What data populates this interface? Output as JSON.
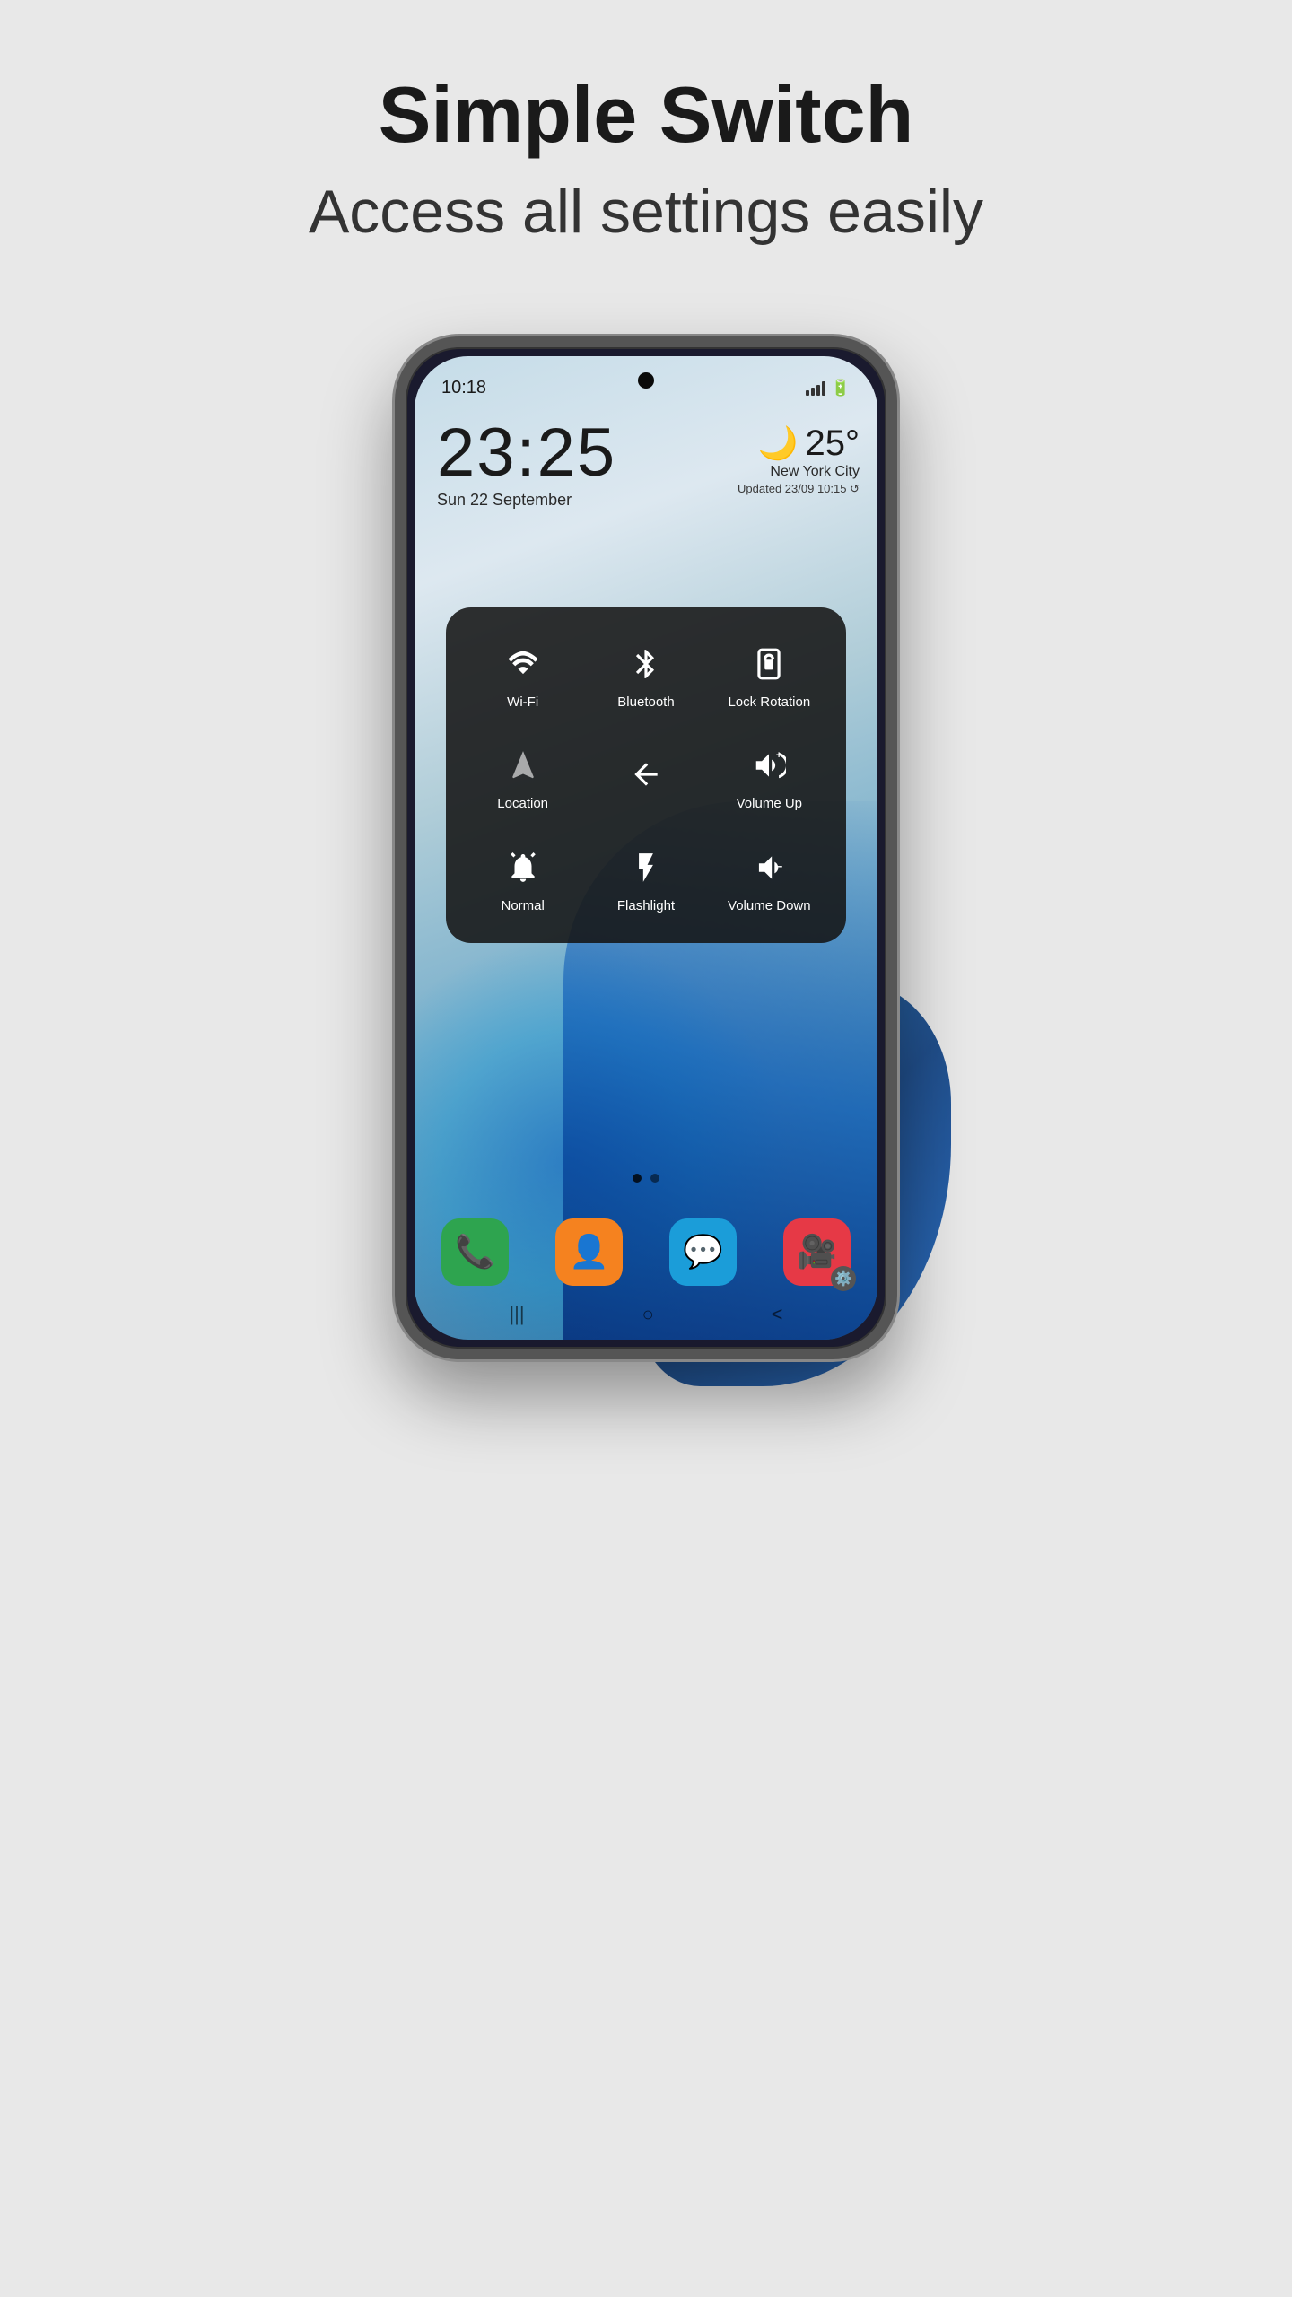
{
  "header": {
    "title": "Simple Switch",
    "subtitle": "Access all settings easily"
  },
  "phone": {
    "status_bar": {
      "time": "10:18",
      "circle_icon": "○"
    },
    "clock": {
      "time": "23:25",
      "date": "Sun 22 September"
    },
    "weather": {
      "icon": "🌙",
      "temp": "25°",
      "city": "New York City",
      "updated": "Updated 23/09 10:15 ↺"
    },
    "control_panel": {
      "items": [
        {
          "id": "wifi",
          "label": "Wi-Fi",
          "icon": "wifi"
        },
        {
          "id": "bluetooth",
          "label": "Bluetooth",
          "icon": "bluetooth"
        },
        {
          "id": "lock-rotation",
          "label": "Lock\nRotation",
          "icon": "lock-rotation"
        },
        {
          "id": "location",
          "label": "Location",
          "icon": "location"
        },
        {
          "id": "back",
          "label": "",
          "icon": "back-arrow"
        },
        {
          "id": "volume-up",
          "label": "Volume Up",
          "icon": "volume-up"
        },
        {
          "id": "normal",
          "label": "Normal",
          "icon": "bell"
        },
        {
          "id": "flashlight",
          "label": "Flashlight",
          "icon": "flashlight"
        },
        {
          "id": "volume-down",
          "label": "Volume\nDown",
          "icon": "volume-down"
        }
      ]
    },
    "app_dock": [
      {
        "id": "phone",
        "label": "Phone",
        "emoji": "📞"
      },
      {
        "id": "contacts",
        "label": "Contacts",
        "emoji": "👤"
      },
      {
        "id": "messages",
        "label": "Messages",
        "emoji": "💬"
      },
      {
        "id": "settings",
        "label": "Settings",
        "emoji": "🎥"
      }
    ],
    "nav": {
      "back": "|||",
      "home": "○",
      "recent": "<"
    }
  }
}
